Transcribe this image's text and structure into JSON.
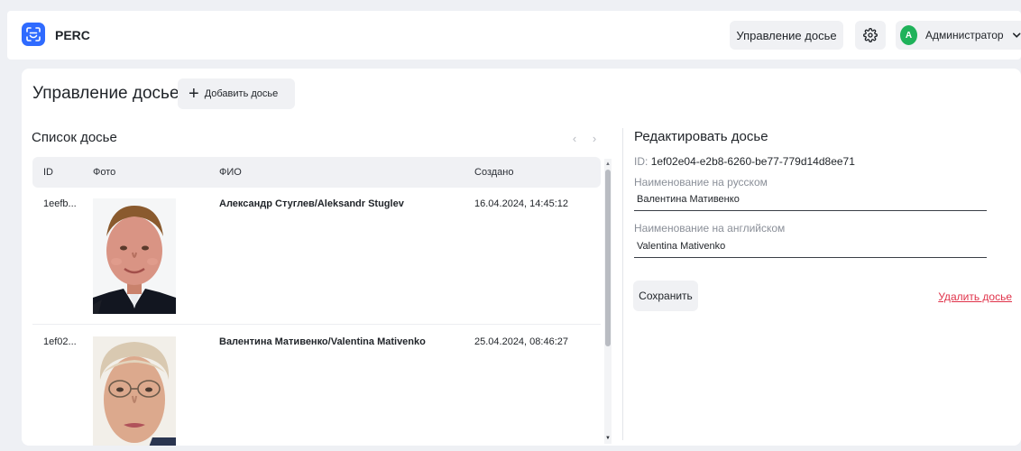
{
  "header": {
    "brand": "PERC",
    "manage_label": "Управление досье",
    "settings_icon": "gear-icon",
    "user": {
      "initial": "A",
      "name": "Администратор",
      "avatar_color": "#1fb25a"
    }
  },
  "page": {
    "title": "Управление досье",
    "add_label": "Добавить досье"
  },
  "list": {
    "title": "Список досье",
    "columns": {
      "id": "ID",
      "photo": "Фото",
      "fio": "ФИО",
      "created": "Создано"
    },
    "rows": [
      {
        "id": "1eefb...",
        "fio": "Александр Стуглев/Aleksandr Stuglev",
        "created": "16.04.2024, 14:45:12"
      },
      {
        "id": "1ef02...",
        "fio": "Валентина Мативенко/Valentina Mativenko",
        "created": "25.04.2024, 08:46:27"
      }
    ]
  },
  "edit": {
    "title": "Редактировать досье",
    "id_prefix": "ID:",
    "id_value": "1ef02e04-e2b8-6260-be77-779d14d8ee71",
    "ru_label": "Наименование на русском",
    "ru_value": "Валентина Мативенко",
    "en_label": "Наименование на английском",
    "en_value": "Valentina Mativenko",
    "save_label": "Сохранить",
    "delete_label": "Удалить досье"
  },
  "colors": {
    "accent": "#2f6bff",
    "danger": "#e0334a",
    "surface": "#f0f1f4"
  }
}
